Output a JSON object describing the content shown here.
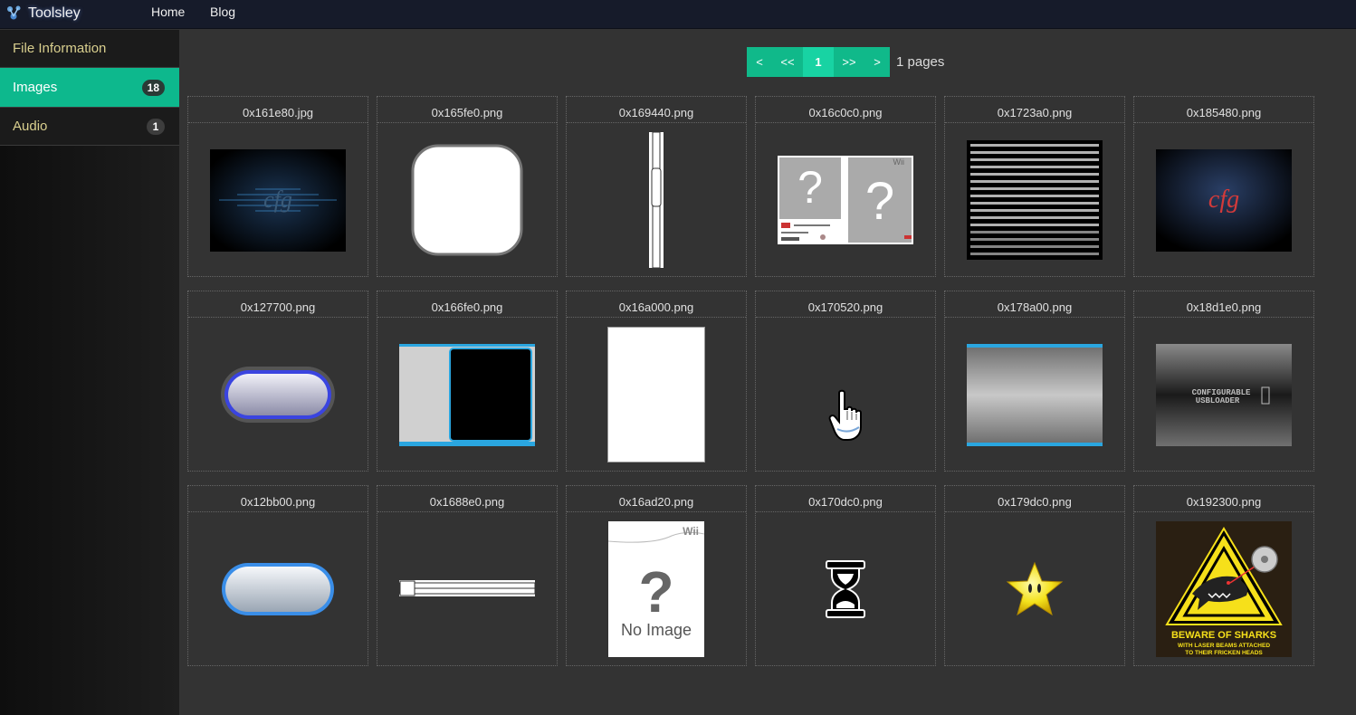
{
  "header": {
    "brand": "Toolsley",
    "nav": [
      "Home",
      "Blog"
    ]
  },
  "sidebar": {
    "items": [
      {
        "label": "File Information",
        "count": null,
        "active": false
      },
      {
        "label": "Images",
        "count": "18",
        "active": true
      },
      {
        "label": "Audio",
        "count": "1",
        "active": false
      }
    ]
  },
  "pagination": {
    "buttons": [
      "<",
      "<<",
      "1",
      ">>",
      ">"
    ],
    "current": "1",
    "summary": "1 pages"
  },
  "images": [
    {
      "name": "0x161e80.jpg",
      "preview": "dark-wave-cfg"
    },
    {
      "name": "0x165fe0.png",
      "preview": "white-rounded-square"
    },
    {
      "name": "0x169440.png",
      "preview": "vertical-scrollbar"
    },
    {
      "name": "0x16c0c0.png",
      "preview": "wii-box-unknown"
    },
    {
      "name": "0x1723a0.png",
      "preview": "font-sheet"
    },
    {
      "name": "0x185480.png",
      "preview": "cfg-logo-dark"
    },
    {
      "name": "0x127700.png",
      "preview": "blue-pill-button"
    },
    {
      "name": "0x166fe0.png",
      "preview": "black-panel-frame"
    },
    {
      "name": "0x16a000.png",
      "preview": "white-page"
    },
    {
      "name": "0x170520.png",
      "preview": "hand-pointer-cursor"
    },
    {
      "name": "0x178a00.png",
      "preview": "grey-gradient-bar"
    },
    {
      "name": "0x18d1e0.png",
      "preview": "usb-loader-banner"
    },
    {
      "name": "0x12bb00.png",
      "preview": "light-blue-pill-button"
    },
    {
      "name": "0x1688e0.png",
      "preview": "horizontal-slider"
    },
    {
      "name": "0x16ad20.png",
      "preview": "wii-no-image"
    },
    {
      "name": "0x170dc0.png",
      "preview": "hourglass-icon"
    },
    {
      "name": "0x179dc0.png",
      "preview": "star-icon"
    },
    {
      "name": "0x192300.png",
      "preview": "beware-of-sharks-sign"
    }
  ],
  "preview_text": {
    "cfg": "cfg",
    "wii": "Wii",
    "no_image": "No Image",
    "usb_line1": "CONFIGURABLE",
    "usb_line2": "USBLOADER",
    "sharks_title": "BEWARE OF SHARKS",
    "sharks_sub1": "WITH LASER BEAMS ATTACHED",
    "sharks_sub2": "TO THEIR FRICKEN HEADS"
  },
  "colors": {
    "accent": "#10b98a",
    "header_bg": "#161b2a",
    "content_bg": "#333333",
    "sidebar_text": "#d9cf8e"
  }
}
